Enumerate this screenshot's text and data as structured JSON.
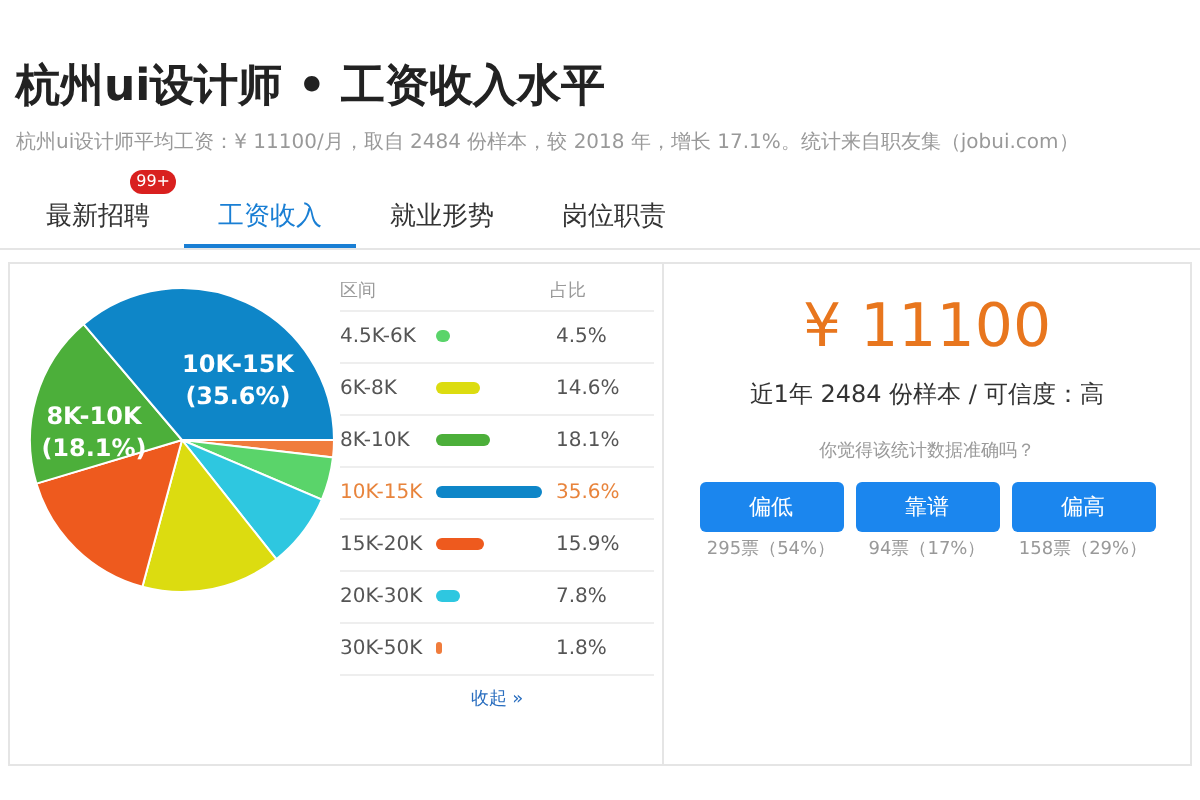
{
  "title": "杭州ui设计师 • 工资收入水平",
  "subtitle": "杭州ui设计师平均工资：¥ 11100/月，取自 2484 份样本，较 2018 年，增长 17.1%。统计来自职友集（jobui.com）",
  "tabs": [
    {
      "label": "最新招聘",
      "selected": false,
      "badge": "99+"
    },
    {
      "label": "工资收入",
      "selected": true
    },
    {
      "label": "就业形势",
      "selected": false
    },
    {
      "label": "岗位职责",
      "selected": false
    }
  ],
  "pie": {
    "chart_data": {
      "type": "pie",
      "series": [
        {
          "values": [
            1.8,
            4.5,
            7.8,
            14.6,
            15.9,
            18.1,
            35.6
          ]
        }
      ],
      "colors": [
        "#f07c3c",
        "#5ad46a",
        "#2ec7e0",
        "#dcdc10",
        "#ee5a1e",
        "#4caf3a",
        "#0e86c8"
      ],
      "annotations": [
        {
          "text": "10K-15K"
        },
        {
          "text": "(35.6%)"
        },
        {
          "text": "8K-10K"
        },
        {
          "text": "(18.1%)"
        }
      ]
    }
  },
  "table": {
    "columns": [
      "区间",
      "占比"
    ],
    "rows": [
      {
        "range": "4.5K-6K",
        "color": "#5ad46a",
        "share": "4.5%",
        "selected": false
      },
      {
        "range": "6K-8K",
        "color": "#dcdc10",
        "share": "14.6%",
        "selected": false
      },
      {
        "range": "8K-10K",
        "color": "#4caf3a",
        "share": "18.1%",
        "selected": false
      },
      {
        "range": "10K-15K",
        "color": "#0e86c8",
        "share": "35.6%",
        "selected": true
      },
      {
        "range": "15K-20K",
        "color": "#ee5a1e",
        "share": "15.9%",
        "selected": false
      },
      {
        "range": "20K-30K",
        "color": "#2ec7e0",
        "share": "7.8%",
        "selected": false
      },
      {
        "range": "30K-50K",
        "color": "#f07c3c",
        "share": "1.8%",
        "selected": false
      }
    ],
    "collapse_link": "收起 »"
  },
  "summary": {
    "salary": "¥ 11100",
    "detail": "近1年 2484 份样本 / 可信度：高",
    "question": "你觉得该统计数据准确吗？",
    "votes": [
      {
        "label": "偏低",
        "count": "295票（54%）"
      },
      {
        "label": "靠谱",
        "count": "94票（17%）"
      },
      {
        "label": "偏高",
        "count": "158票（29%）"
      }
    ]
  }
}
